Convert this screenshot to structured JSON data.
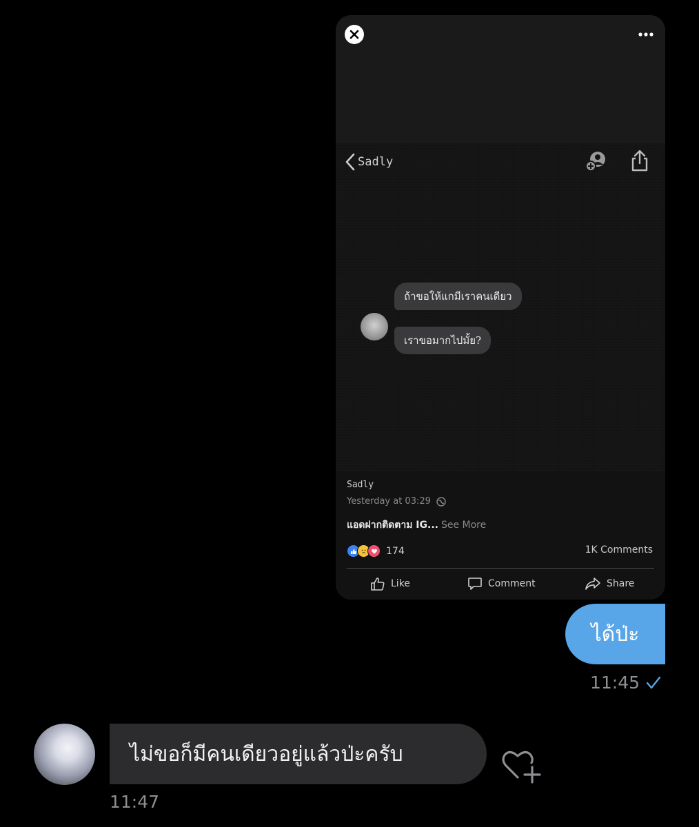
{
  "shared_post": {
    "header": {
      "back_label": "Sadly"
    },
    "messages": [
      "ถ้าขอให้แกมีเราคนเดียว",
      "เราขอมากไปมั้ย?"
    ],
    "author": "Sadly",
    "timestamp": "Yesterday at 03:29",
    "caption_bold": "แอดฝากติดตาม IG...",
    "caption_more": "See More",
    "reaction_count": "174",
    "comments_count": "1K Comments",
    "actions": {
      "like": "Like",
      "comment": "Comment",
      "share": "Share"
    }
  },
  "conversation": {
    "outgoing": {
      "text": "ได้ป่ะ",
      "time": "11:45"
    },
    "incoming": {
      "text": "ไม่ขอก็มีคนเดียวอยู่แล้วป่ะครับ",
      "time": "11:47"
    }
  },
  "colors": {
    "background": "#000000",
    "outgoing_bubble": "#58a6e8",
    "incoming_bubble": "#2c2c2e",
    "timestamp": "#8e8e93",
    "read_check": "#58a6e8"
  }
}
